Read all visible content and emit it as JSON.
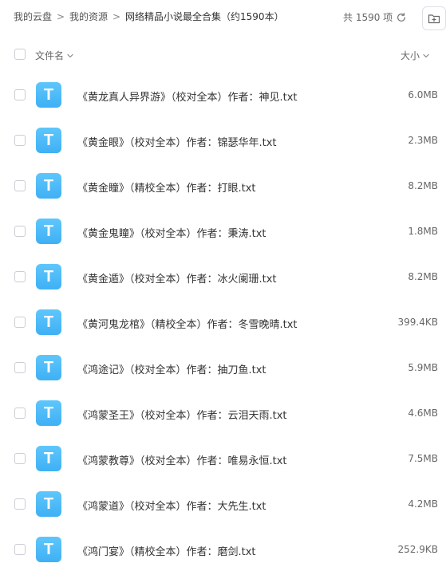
{
  "breadcrumb": {
    "items": [
      "我的云盘",
      "我的资源",
      "网络精品小说最全合集（约1590本）"
    ]
  },
  "summary": {
    "count_text": "共 1590 项"
  },
  "icons": {
    "refresh": "refresh-icon",
    "new_folder": "folder-add-icon",
    "file": "txt-file-icon",
    "file_letter": "T"
  },
  "colors": {
    "file_icon": "#4cbcf8",
    "text": "#333333",
    "muted": "#666666"
  },
  "list_header": {
    "name_label": "文件名",
    "size_label": "大小"
  },
  "files": [
    {
      "name": "《黄龙真人异界游》（校对全本）作者：神见.txt",
      "size": "6.0MB"
    },
    {
      "name": "《黄金眼》（校对全本）作者：锦瑟华年.txt",
      "size": "2.3MB"
    },
    {
      "name": "《黄金瞳》（精校全本）作者：打眼.txt",
      "size": "8.2MB"
    },
    {
      "name": "《黄金鬼瞳》（校对全本）作者：秉涛.txt",
      "size": "1.8MB"
    },
    {
      "name": "《黄金遁》（校对全本）作者：冰火阑珊.txt",
      "size": "8.2MB"
    },
    {
      "name": "《黄河鬼龙棺》（精校全本）作者：冬雪晚晴.txt",
      "size": "399.4KB"
    },
    {
      "name": "《鸿途记》（校对全本）作者：抽刀鱼.txt",
      "size": "5.9MB"
    },
    {
      "name": "《鸿蒙圣王》（校对全本）作者：云泪天雨.txt",
      "size": "4.6MB"
    },
    {
      "name": "《鸿蒙教尊》（校对全本）作者：唯易永恒.txt",
      "size": "7.5MB"
    },
    {
      "name": "《鸿蒙道》（校对全本）作者：大先生.txt",
      "size": "4.2MB"
    },
    {
      "name": "《鸿门宴》（精校全本）作者：磨剑.txt",
      "size": "252.9KB"
    }
  ]
}
